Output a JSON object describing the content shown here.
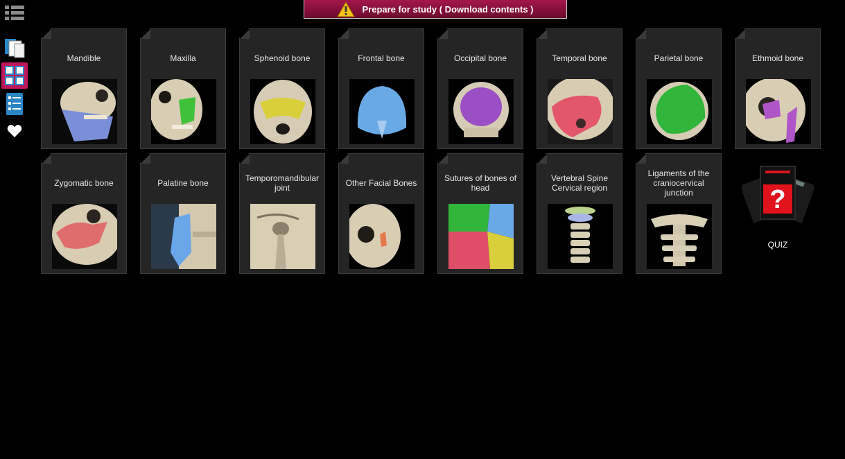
{
  "banner": {
    "text": "Prepare for study ( Download contents )"
  },
  "sidebar": {
    "items": [
      {
        "name": "menu-list-icon"
      },
      {
        "name": "library-books-icon"
      },
      {
        "name": "grid-view-icon"
      },
      {
        "name": "list-view-icon"
      },
      {
        "name": "favorites-heart-icon"
      }
    ]
  },
  "cards": [
    {
      "title": "Mandible",
      "highlight": "#7b8fd8"
    },
    {
      "title": "Maxilla",
      "highlight": "#3fc23a"
    },
    {
      "title": "Sphenoid bone",
      "highlight": "#d9cf3a"
    },
    {
      "title": "Frontal bone",
      "highlight": "#69a9e6"
    },
    {
      "title": "Occipital bone",
      "highlight": "#9c4fc4"
    },
    {
      "title": "Temporal bone",
      "highlight": "#e4566c"
    },
    {
      "title": "Parietal bone",
      "highlight": "#31b53a"
    },
    {
      "title": "Ethmoid bone",
      "highlight": "#b055c8"
    },
    {
      "title": "Zygomatic bone",
      "highlight": "#e06d6d"
    },
    {
      "title": "Palatine bone",
      "highlight": "#6aa7e8"
    },
    {
      "title": "Temporomandibular joint",
      "highlight": "#d8cfb5"
    },
    {
      "title": "Other Facial Bones",
      "highlight": "#e47a4a"
    },
    {
      "title": "Sutures of bones of head",
      "highlight": "#e04d66"
    },
    {
      "title": "Vertebral Spine Cervical region",
      "highlight": "#a9b6e8"
    },
    {
      "title": "Ligaments of the craniocervical junction",
      "highlight": "#d8d0b6"
    }
  ],
  "quiz": {
    "label": "QUIZ"
  },
  "colors": {
    "background": "#000000",
    "card": "#252525",
    "accent": "#c0175d",
    "banner": "#8e1240"
  }
}
